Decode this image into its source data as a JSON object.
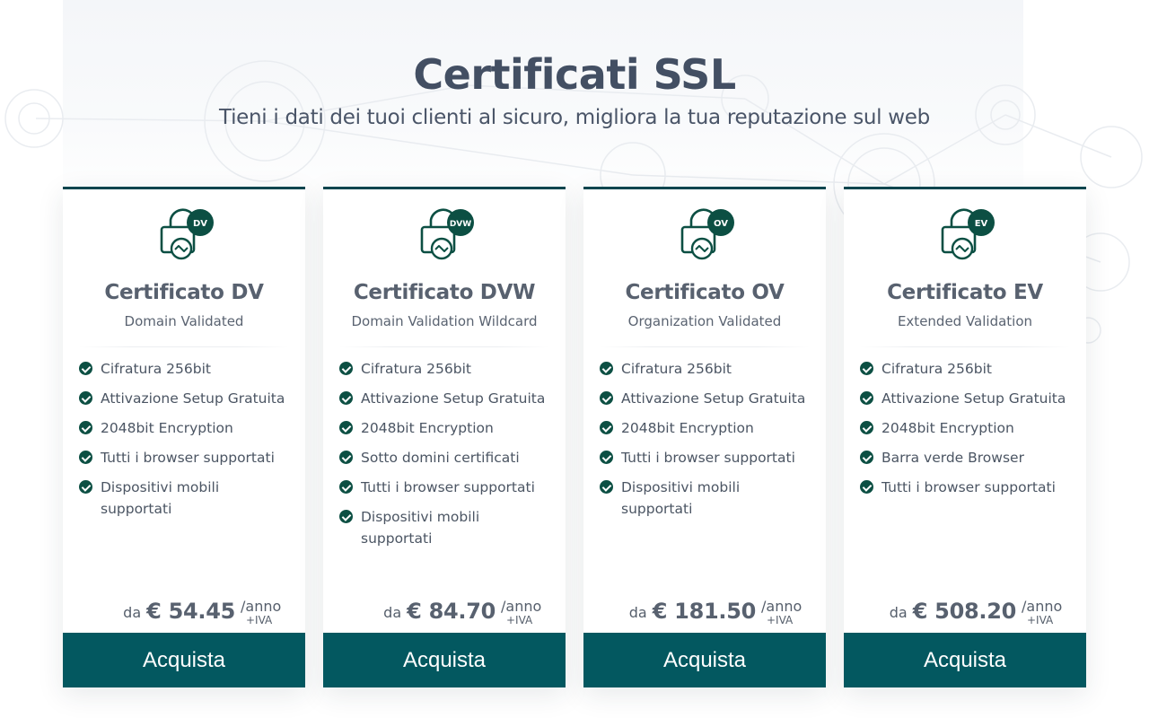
{
  "header": {
    "title": "Certificati SSL",
    "subtitle": "Tieni i dati dei tuoi clienti al sicuro, migliora la tua reputazione sul web"
  },
  "colors": {
    "accent": "#07454e",
    "button": "#035860",
    "check": "#0c4f43",
    "title": "#434f63"
  },
  "cards": [
    {
      "badge": "DV",
      "title": "Certificato DV",
      "subtitle": "Domain Validated",
      "features": [
        "Cifratura 256bit",
        "Attivazione Setup Gratuita",
        "2048bit Encryption",
        "Tutti i browser supportati",
        "Dispositivi mobili supportati"
      ],
      "price_prefix": "da",
      "price": "€ 54.45",
      "period": "/anno",
      "tax": "+IVA",
      "button_label": "Acquista",
      "icon": "ssl-lock-icon"
    },
    {
      "badge": "DVW",
      "title": "Certificato DVW",
      "subtitle": "Domain Validation Wildcard",
      "features": [
        "Cifratura 256bit",
        "Attivazione Setup Gratuita",
        "2048bit Encryption",
        "Sotto domini certificati",
        "Tutti i browser supportati",
        "Dispositivi mobili supportati"
      ],
      "price_prefix": "da",
      "price": "€ 84.70",
      "period": "/anno",
      "tax": "+IVA",
      "button_label": "Acquista",
      "icon": "ssl-lock-icon"
    },
    {
      "badge": "OV",
      "title": "Certificato OV",
      "subtitle": "Organization Validated",
      "features": [
        "Cifratura 256bit",
        "Attivazione Setup Gratuita",
        "2048bit Encryption",
        "Tutti i browser supportati",
        "Dispositivi mobili supportati"
      ],
      "price_prefix": "da",
      "price": "€ 181.50",
      "period": "/anno",
      "tax": "+IVA",
      "button_label": "Acquista",
      "icon": "ssl-lock-icon"
    },
    {
      "badge": "EV",
      "title": "Certificato EV",
      "subtitle": "Extended Validation",
      "features": [
        "Cifratura 256bit",
        "Attivazione Setup Gratuita",
        "2048bit Encryption",
        "Barra verde Browser",
        "Tutti i browser supportati"
      ],
      "price_prefix": "da",
      "price": "€ 508.20",
      "period": "/anno",
      "tax": "+IVA",
      "button_label": "Acquista",
      "icon": "ssl-lock-icon"
    }
  ]
}
